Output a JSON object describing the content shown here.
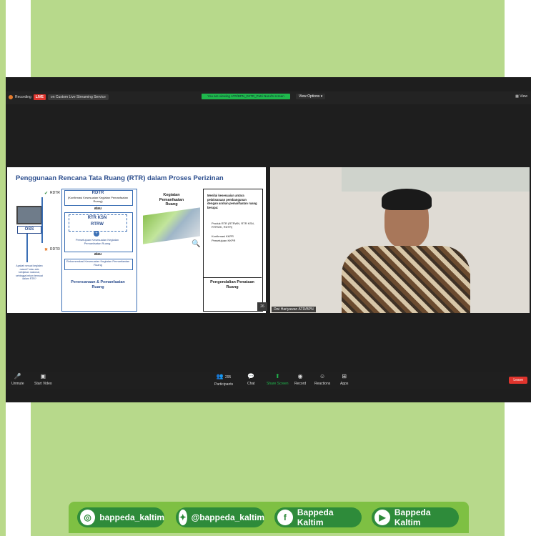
{
  "zoom": {
    "recording_label": "Recording",
    "live_label": "LIVE",
    "stream_label": "on Custom Live Streaming Service",
    "viewing_banner": "You are viewing ATR/BPN_DJTR_Putri Nurul's screen",
    "view_options": "View Options",
    "view_label": "View",
    "participant_name": "Dwi Hariyawan ATR/BPN",
    "slide_page": "26",
    "participants_count": "295",
    "toolbar": {
      "unmute": "Unmute",
      "start_video": "Start Video",
      "participants": "Participants",
      "chat": "Chat",
      "share_screen": "Share Screen",
      "record": "Record",
      "reactions": "Reactions",
      "apps": "Apps",
      "leave": "Leave"
    }
  },
  "slide": {
    "title": "Penggunaan Rencana Tata Ruang (RTR) dalam Proses Perizinan",
    "rdtr_top": "RDTR",
    "rdtr_bottom": "RDTR",
    "oss": "OSS",
    "box1_title": "RDTR",
    "box1_sub": "(Konfirmasi Kesesuaian Kegiatan Pemanfaatan Ruang)",
    "atau1": "atau",
    "rtr_ksn": "RTR KSN",
    "rtrw": "RTRW",
    "persetujuan": "Persetujuan Kesesuaian Kegiatan Pemanfaatan Ruang",
    "atau2": "atau",
    "rekomendasi": "Rekomendasi Kesesuaian Kegiatan Pemanfaatan Ruang",
    "left_note": "Apakah sesuai kegiatan masuk? atau ada kebijakan nasional, sehingga belum termuat dalam RTR?",
    "perencanaan": "Perencanaan & Pemanfaatan Ruang",
    "kegiatan": "Kegiatan Pemanfaatan Ruang",
    "menilai": "Menilai kesesuaian antara pelaksanaan pembangunan dengan arahan pemanfaatan ruang berupa:",
    "bullet1": "Produk RTR (RTRWN, RTR KSN, RTRWK, RDTR)",
    "bullet2": "Konfirmasi KKPR",
    "bullet3": "Persetujuan KKPR",
    "pengendalian": "Pengendalian Penataan Ruang"
  },
  "social": {
    "instagram": "bappeda_kaltim",
    "twitter": "@bappeda_kaltim",
    "facebook": "Bappeda Kaltim",
    "youtube": "Bappeda Kaltim"
  }
}
